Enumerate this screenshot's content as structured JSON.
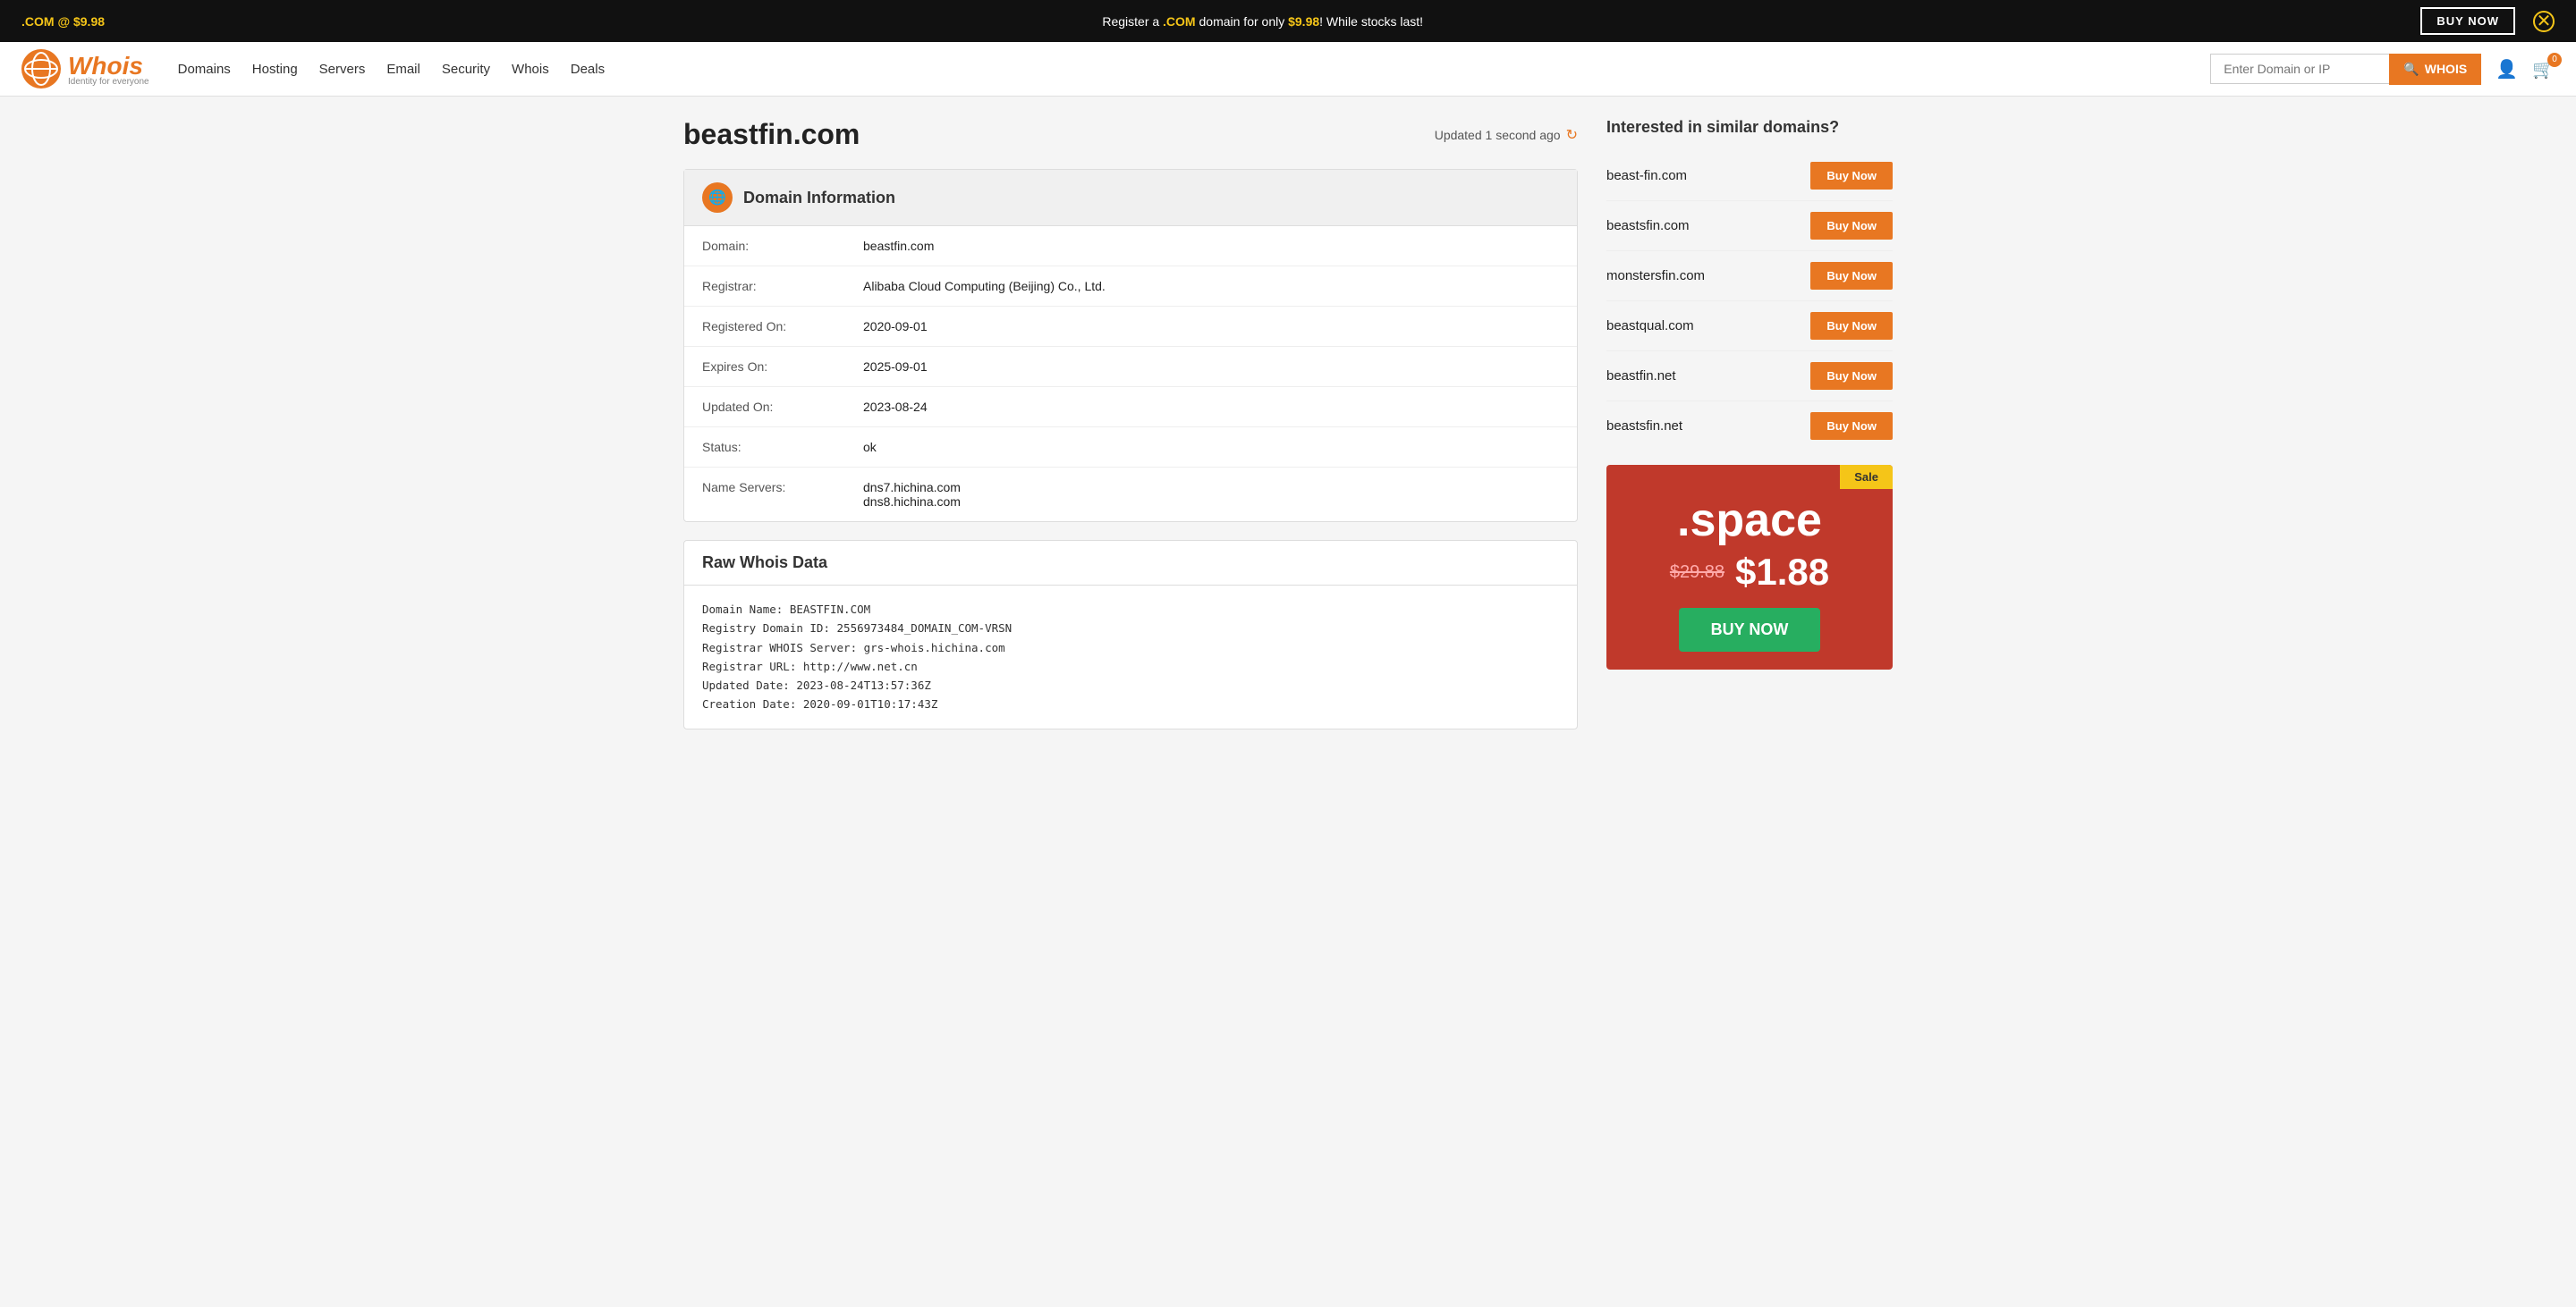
{
  "banner": {
    "left_text": ".COM @ $9.98",
    "center_text_before": "Register a ",
    "center_highlight": ".COM",
    "center_text_after": " domain for only ",
    "center_price": "$9.98",
    "center_text_end": "! While stocks last!",
    "buy_now_label": "BUY NOW",
    "close_icon": "✕"
  },
  "navbar": {
    "logo_text": "Whois",
    "logo_sub": "Identity for everyone",
    "links": [
      {
        "label": "Domains"
      },
      {
        "label": "Hosting"
      },
      {
        "label": "Servers"
      },
      {
        "label": "Email"
      },
      {
        "label": "Security"
      },
      {
        "label": "Whois"
      },
      {
        "label": "Deals"
      }
    ],
    "search_placeholder": "Enter Domain or IP",
    "search_btn_label": "WHOIS",
    "cart_count": "0"
  },
  "page": {
    "domain": "beastfin.com",
    "updated_text": "Updated 1 second ago",
    "domain_info": {
      "header": "Domain Information",
      "rows": [
        {
          "label": "Domain:",
          "value": "beastfin.com"
        },
        {
          "label": "Registrar:",
          "value": "Alibaba Cloud Computing (Beijing) Co., Ltd."
        },
        {
          "label": "Registered On:",
          "value": "2020-09-01"
        },
        {
          "label": "Expires On:",
          "value": "2025-09-01"
        },
        {
          "label": "Updated On:",
          "value": "2023-08-24"
        },
        {
          "label": "Status:",
          "value": "ok"
        },
        {
          "label": "Name Servers:",
          "value": "dns7.hichina.com\ndns8.hichina.com"
        }
      ]
    },
    "raw_whois": {
      "header": "Raw Whois Data",
      "content": "Domain Name: BEASTFIN.COM\nRegistry Domain ID: 2556973484_DOMAIN_COM-VRSN\nRegistrar WHOIS Server: grs-whois.hichina.com\nRegistrar URL: http://www.net.cn\nUpdated Date: 2023-08-24T13:57:36Z\nCreation Date: 2020-09-01T10:17:43Z"
    }
  },
  "sidebar": {
    "similar_title": "Interested in similar domains?",
    "suggestions": [
      {
        "name": "beast-fin.com",
        "btn": "Buy Now"
      },
      {
        "name": "beastsfin.com",
        "btn": "Buy Now"
      },
      {
        "name": "monstersfin.com",
        "btn": "Buy Now"
      },
      {
        "name": "beastqual.com",
        "btn": "Buy Now"
      },
      {
        "name": "beastfin.net",
        "btn": "Buy Now"
      },
      {
        "name": "beastsfin.net",
        "btn": "Buy Now"
      }
    ],
    "sale": {
      "badge": "Sale",
      "tld": ".space",
      "original_price": "$29.88",
      "new_price": "$1.88",
      "btn_label": "BUY NOW"
    }
  }
}
